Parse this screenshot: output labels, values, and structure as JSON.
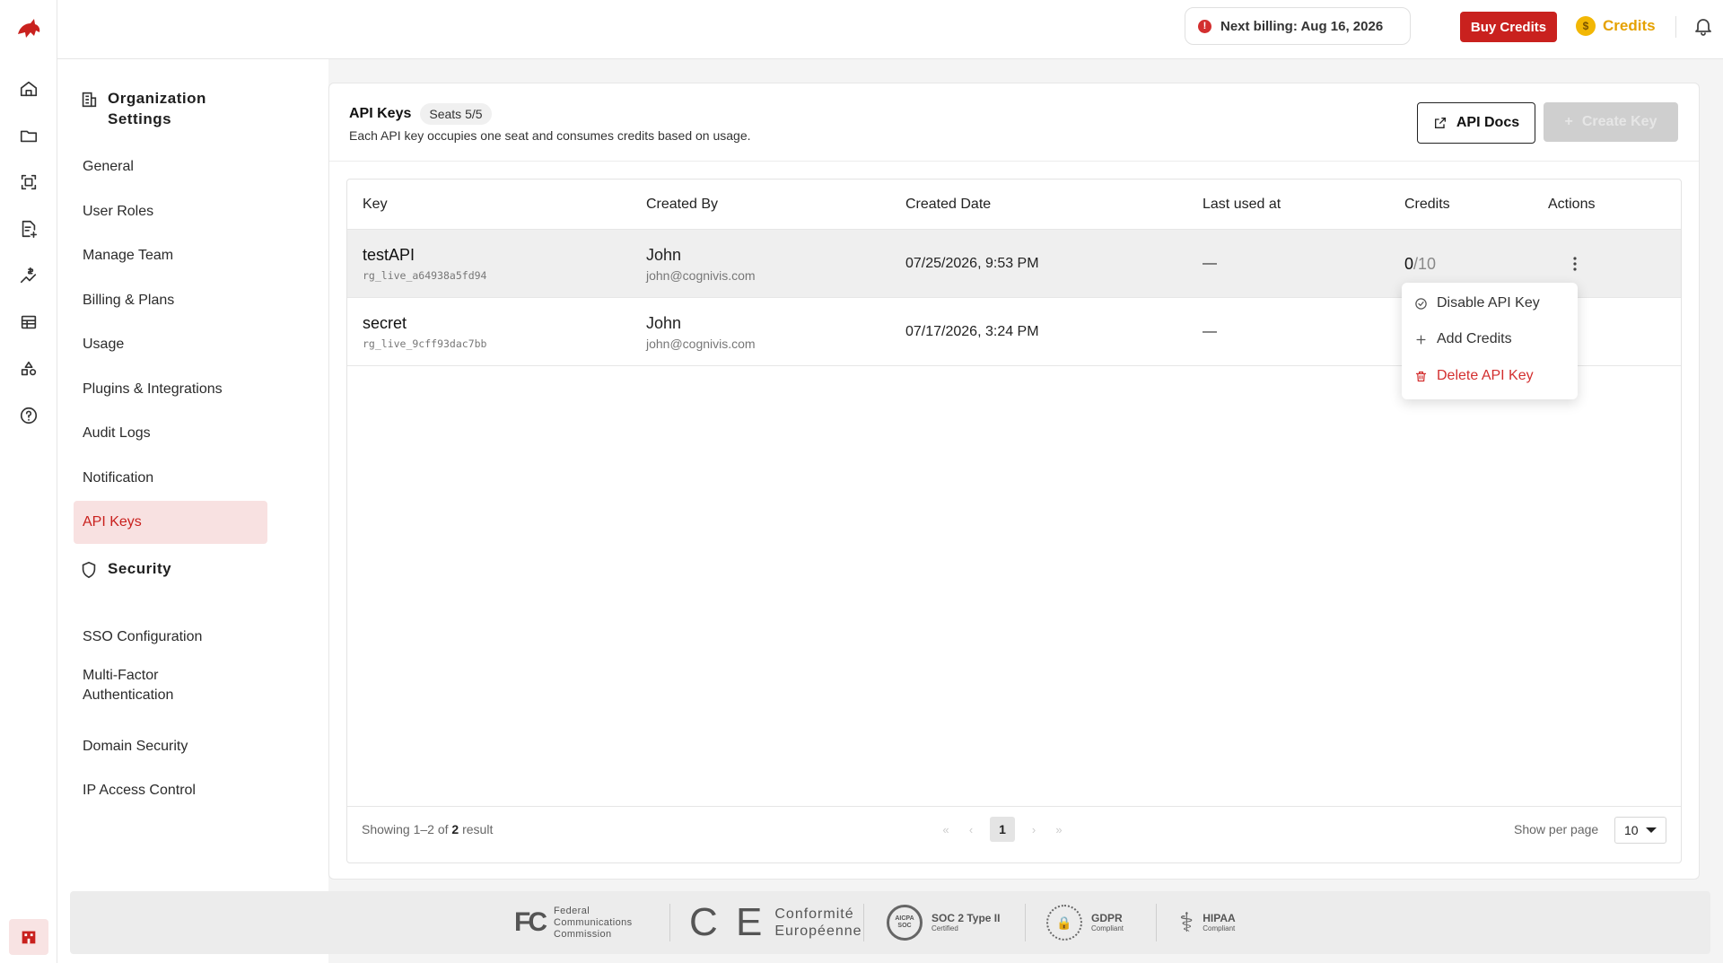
{
  "topbar": {
    "billing_notice": "Next billing: Aug 16, 2026",
    "buy_credits_label": "Buy Credits",
    "credits_label": "Credits",
    "credits_coin": "$"
  },
  "sidebar": {
    "org_heading": "Organization Settings",
    "org_items": [
      "General",
      "User Roles",
      "Manage Team",
      "Billing & Plans",
      "Usage",
      "Plugins & Integrations",
      "Audit Logs",
      "Notification",
      "API Keys"
    ],
    "active_item": "API Keys",
    "security_heading": "Security",
    "security_items": [
      "SSO Configuration",
      "Multi-Factor Authentication",
      "Domain Security",
      "IP Access Control"
    ]
  },
  "card": {
    "title": "API Keys",
    "seats": "Seats 5/5",
    "description": "Each API key occupies one seat and consumes credits based on usage.",
    "api_docs_label": "API Docs",
    "create_key_label": "Create Key"
  },
  "table": {
    "columns": [
      "Key",
      "Created By",
      "Created Date",
      "Last used at",
      "Credits",
      "Actions"
    ],
    "rows": [
      {
        "name": "testAPI",
        "key": "rg_live_a64938a5fd94",
        "user": "John",
        "email": "john@cognivis.com",
        "created": "07/25/2026, 9:53 PM",
        "last_used": "—",
        "credits_used": "0",
        "credits_total": "/10"
      },
      {
        "name": "secret",
        "key": "rg_live_9cff93dac7bb",
        "user": "John",
        "email": "john@cognivis.com",
        "created": "07/17/2026, 3:24 PM",
        "last_used": "—",
        "credits_used": "",
        "credits_total": ""
      }
    ]
  },
  "action_menu": {
    "disable": "Disable API Key",
    "add_credits": "Add Credits",
    "delete": "Delete API Key"
  },
  "pagination": {
    "showing_prefix": "Showing 1–2 of ",
    "total": "2",
    "showing_suffix": " result",
    "current_page": "1",
    "per_page_label": "Show per page",
    "per_page_value": "10"
  },
  "compliance": {
    "fcc_symbol": "FC",
    "fcc_lines": [
      "Federal",
      "Communications",
      "Commission"
    ],
    "ce_symbol": "C E",
    "ce_lines": [
      "Conformité",
      "Européenne"
    ],
    "soc_seal": "AICPA SOC",
    "soc_title": "SOC 2 Type II",
    "soc_sub": "Certified",
    "gdpr_title": "GDPR",
    "gdpr_sub": "Compliant",
    "hipaa_title": "HIPAA",
    "hipaa_sub": "Compliant"
  },
  "colors": {
    "brand_red": "#c9211e",
    "credits_gold": "#e5a100",
    "active_bg": "#f8e1e1"
  }
}
